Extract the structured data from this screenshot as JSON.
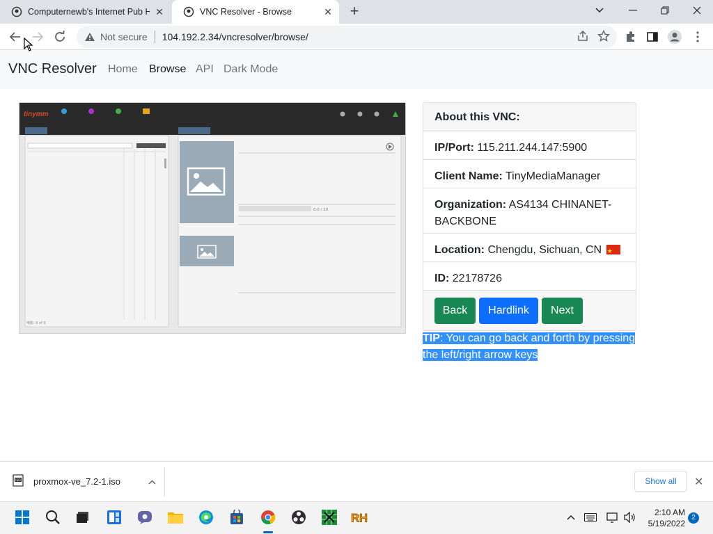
{
  "browser": {
    "tabs": [
      {
        "title": "Computernewb's Internet Pub H",
        "active": false
      },
      {
        "title": "VNC Resolver - Browse",
        "active": true
      }
    ],
    "omnibox": {
      "security": "Not secure",
      "url": "104.192.2.34/vncresolver/browse/"
    }
  },
  "nav": {
    "brand": "VNC Resolver",
    "links": [
      "Home",
      "Browse",
      "API",
      "Dark Mode"
    ],
    "active": "Browse"
  },
  "card": {
    "header": "About this VNC:",
    "fields": [
      {
        "label": "IP/Port:",
        "value": "115.211.244.147:5900"
      },
      {
        "label": "Client Name:",
        "value": "TinyMediaManager"
      },
      {
        "label": "Organization:",
        "value": "AS4134 CHINANET-BACKBONE"
      },
      {
        "label": "Location:",
        "value": "Chengdu, Sichuan, CN"
      },
      {
        "label": "ID:",
        "value": "22178726"
      }
    ],
    "buttons": {
      "back": "Back",
      "hardlink": "Hardlink",
      "next": "Next"
    }
  },
  "tip": {
    "bold": "TIP",
    "text": ": You can go back and forth by pressing the left/right arrow keys"
  },
  "screenshot": {
    "logo": "tinymm",
    "rating": "0.0 / 10",
    "status": "电影: 0 of 0"
  },
  "downloads": {
    "file": "proxmox-ve_7.2-1.iso",
    "show_all": "Show all"
  },
  "taskbar": {
    "time": "2:10 AM",
    "date": "5/19/2022",
    "badge": "2"
  },
  "colors": {
    "green": "#198754",
    "blue": "#0d6efd",
    "selection": "#3390ff"
  }
}
